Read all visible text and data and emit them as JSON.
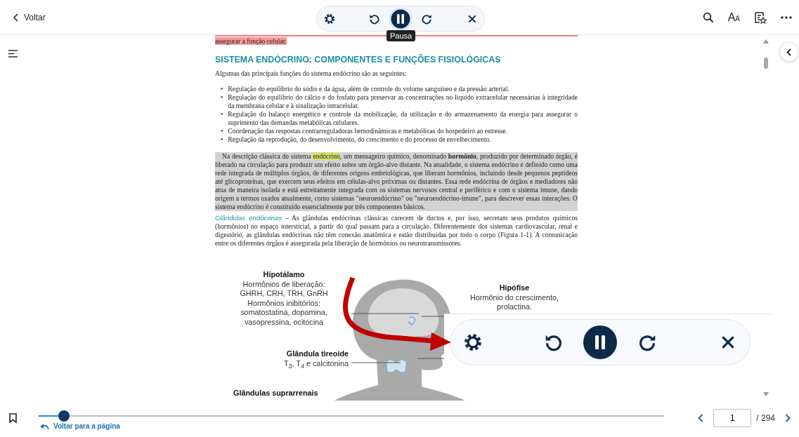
{
  "top_bar": {
    "back_label": "Voltar",
    "text_size_glyph": [
      "A",
      "A"
    ]
  },
  "player": {
    "buttons": [
      {
        "kind": "settings"
      },
      {
        "kind": "rewind"
      },
      {
        "kind": "pause"
      },
      {
        "kind": "forward"
      },
      {
        "kind": "close"
      }
    ],
    "tooltip": "Pausa"
  },
  "document": {
    "previous_line": {
      "text": "assegurar a função celular.",
      "highlighted": true
    },
    "heading": "SISTEMA ENDÓCRINO: COMPONENTES E FUNÇÕES FISIOLÓGICAS",
    "intro": "Algumas das principais funções do sistema endócrino são as seguintes:",
    "bullet_marker": "•",
    "bullets": [
      "Regulação do equilíbrio do sódio e da água, além de controle do volume sanguíneo e da pressão arterial.",
      "Regulação do equilíbrio do cálcio e do fosfato para preservar as concentrações no líquido extracelular necessárias à integridade da membrana celular e à sinalização intracelular.",
      "Regulação do balanço energético e controle da mobilização, da utilização e do armazenamento da energia para assegurar o suprimento das demandas metabólicas celulares.",
      "Coordenação das respostas contrarreguladoras hemodinâmicas e metabólicas do hospedeiro ao estresse.",
      "Regulação da reprodução, do desenvolvimento, do crescimento e do processo de envelhecimento."
    ],
    "paragraph": {
      "read_aloud": true,
      "segments": [
        {
          "text": "Na descrição clássica do sistema ",
          "highlighted": false
        },
        {
          "text": "endócrino",
          "highlighted": true
        },
        {
          "text": ", um mensageiro químico, denominado **hormônio**, produzido por determinado órgão, é liberado na circulação para produzir um efeito sobre um órgão-alvo distante. Na atualidade, o sistema endócrino é definido como uma rede integrada de múltiplos órgãos, de diferentes origens embriológicas, que liberam hormônios, incluindo desde pequenos peptídeos até glicoproteínas, que exercem seus efeitos em células-alvo próximas ou distantes. Essa rede endócrina de órgãos e mediadores não atua de maneira isolada e está estreitamente integrada com os sistemas nervosos central e periférico e com o sistema imune, dando origem a termos usados atualmente, como sistemas \"neuroendócrino\" ou \"neuroendócrino-imune\", para descrever essas interações. O sistema endócrino é constituído essencialmente por três componentes básicos.",
          "highlighted": false
        }
      ]
    },
    "glands_paragraph": {
      "term": "Glândulas endócrinas",
      "text": " – As glândulas endócrinas clássicas carecem de ductos e, por isso, secretam seus produtos químicos (hormônios) no espaço intersticial, a partir do qual passam para a circulação. Diferentemente dos sistemas cardiovascular, renal e digestório, as glândulas endócrinas não têm conexão anatômica e estão distribuídas por todo o corpo (Figura 1-1). A comunicação entre os diferentes órgãos é assegurada pela liberação de hormônios ou neurotransmissores."
    }
  },
  "figure": {
    "labels": [
      {
        "kind": "hypothalamus",
        "title": "Hipotálamo",
        "lines": [
          "Hormônios de liberação:",
          "GHRH, CRH, TRH, GnRH",
          "Hormônios inibitórios:",
          "somatostatina, dopamina,",
          "vasopressina, ocitocina"
        ]
      },
      {
        "kind": "pituitary",
        "title": "Hipófise",
        "lines": [
          "Hormônio do crescimento,",
          "prolactina."
        ]
      },
      {
        "kind": "thyroid",
        "title": "Glândula tireoide",
        "lines": [
          "T$_{3}$, T$_{4}$ e calcitonina"
        ]
      },
      {
        "kind": "adrenal",
        "title": "Glândulas suprarrenais"
      }
    ]
  },
  "zoomed_player": {
    "buttons": [
      {
        "kind": "settings"
      },
      {
        "kind": "rewind"
      },
      {
        "kind": "pause"
      },
      {
        "kind": "forward"
      },
      {
        "kind": "close"
      }
    ]
  },
  "bottom_bar": {
    "progress": {
      "level": 0.04
    },
    "back_to_page": "Voltar para a página",
    "page_input": "1",
    "page_total": "/ 294"
  }
}
